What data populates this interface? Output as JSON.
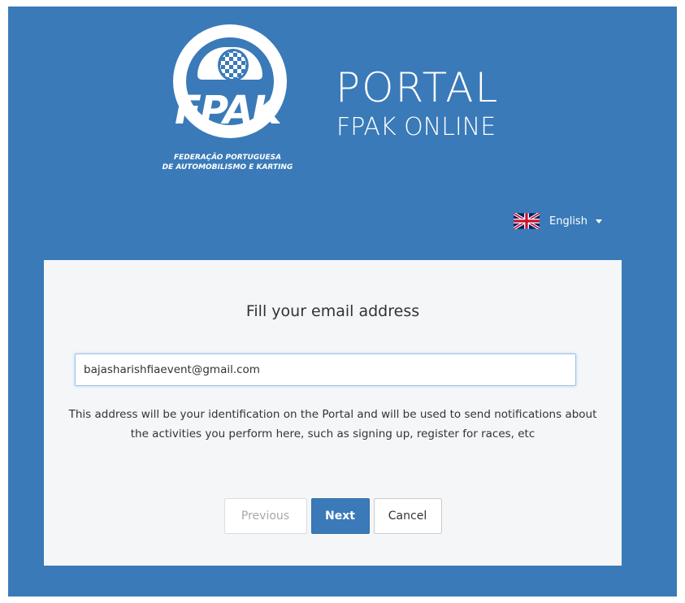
{
  "logo": {
    "text": "FPAK",
    "caption_line1": "FEDERAÇÃO PORTUGUESA",
    "caption_line2": "DE AUTOMOBILISMO E KARTING"
  },
  "header": {
    "title": "PORTAL",
    "subtitle": "FPAK ONLINE"
  },
  "language": {
    "selected": "English",
    "flag_icon": "uk-flag-icon"
  },
  "form": {
    "title": "Fill your email address",
    "email_value": "bajasharishfiaevent@gmail.com",
    "help_text": "This address will be your identification on the Portal and will be used to send notifications about the activities you perform here, such as signing up, register for races, etc"
  },
  "buttons": {
    "previous": "Previous",
    "next": "Next",
    "cancel": "Cancel"
  },
  "colors": {
    "brand_blue": "#3a7ab8",
    "card_bg": "#f4f6f8"
  }
}
